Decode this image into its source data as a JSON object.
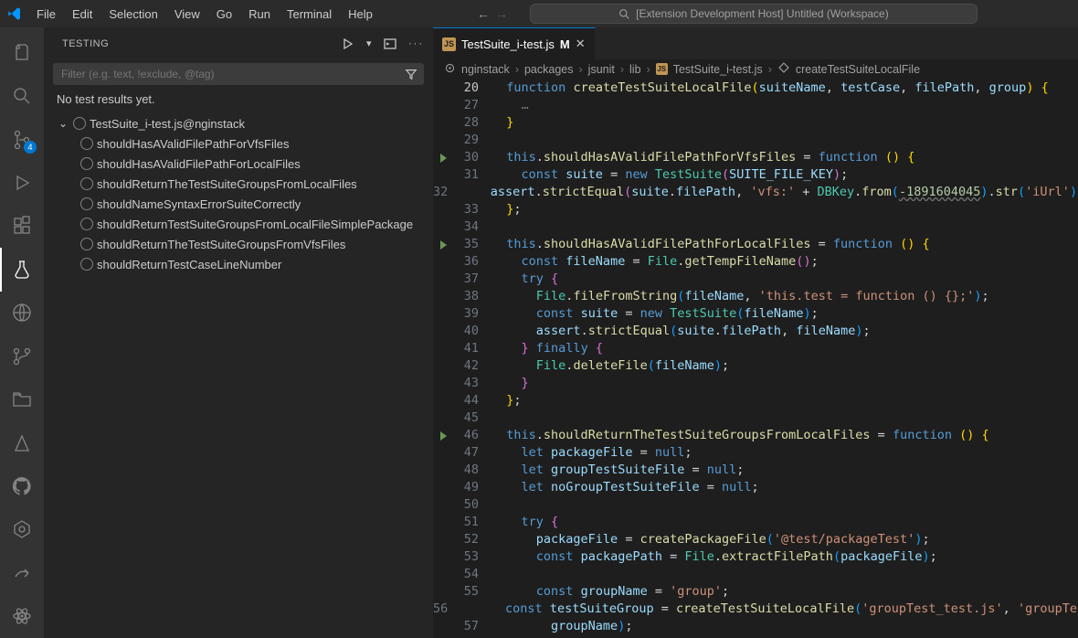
{
  "menu": [
    "File",
    "Edit",
    "Selection",
    "View",
    "Go",
    "Run",
    "Terminal",
    "Help"
  ],
  "title_search": "[Extension Development Host] Untitled (Workspace)",
  "activity_badge": 4,
  "testing": {
    "panel_title": "TESTING",
    "filter_placeholder": "Filter (e.g. text, !exclude, @tag)",
    "no_results": "No test results yet.",
    "suite_label": "TestSuite_i-test.js@nginstack",
    "tests": [
      "shouldHasAValidFilePathForVfsFiles",
      "shouldHasAValidFilePathForLocalFiles",
      "shouldReturnTheTestSuiteGroupsFromLocalFiles",
      "shouldNameSyntaxErrorSuiteCorrectly",
      "shouldReturnTestSuiteGroupsFromLocalFileSimplePackage",
      "shouldReturnTheTestSuiteGroupsFromVfsFiles",
      "shouldReturnTestCaseLineNumber"
    ]
  },
  "tab": {
    "filename": "TestSuite_i-test.js",
    "modified_marker": "M"
  },
  "breadcrumb": [
    "nginstack",
    "packages",
    "jsunit",
    "lib",
    "TestSuite_i-test.js",
    "createTestSuiteLocalFile"
  ],
  "code_lines": [
    {
      "n": 20,
      "c": "",
      "html": "  <span class='kw'>function</span> <span class='fn'>createTestSuiteLocalFile</span><span class='p1'>(</span><span class='vr'>suiteName</span>, <span class='vr'>testCase</span>, <span class='vr'>filePath</span>, <span class='vr'>group</span><span class='p1'>)</span> <span class='p1'>{</span>"
    },
    {
      "n": 27,
      "html": "    <span class='fn' style='color:#6e7681'>…</span>"
    },
    {
      "n": 28,
      "html": "  <span class='p1'>}</span>"
    },
    {
      "n": 29,
      "html": ""
    },
    {
      "n": 30,
      "glyph": true,
      "html": "  <span class='kw'>this</span>.<span class='fn'>shouldHasAValidFilePathForVfsFiles</span> = <span class='kw'>function</span> <span class='p1'>(</span><span class='p1'>)</span> <span class='p1'>{</span>"
    },
    {
      "n": 31,
      "html": "    <span class='kw'>const</span> <span class='vr'>suite</span> = <span class='kw'>new</span> <span class='ty'>TestSuite</span><span class='p2'>(</span><span class='vr'>SUITE_FILE_KEY</span><span class='p2'>)</span>;"
    },
    {
      "n": 32,
      "html": "    <span class='vr'>assert</span>.<span class='fn'>strictEqual</span><span class='p2'>(</span><span class='vr'>suite</span>.<span class='vr'>filePath</span>, <span class='st'>'vfs:'</span> + <span class='ty'>DBKey</span>.<span class='fn'>from</span><span class='p3'>(</span><span class='nm ul'>-1891604045</span><span class='p3'>)</span>.<span class='fn'>str</span><span class='p3'>(</span><span class='st'>'iUrl'</span><span class='p3'>)</span><span class='p2'>)</span>"
    },
    {
      "n": 33,
      "html": "  <span class='p1'>}</span>;"
    },
    {
      "n": 34,
      "html": ""
    },
    {
      "n": 35,
      "glyph": true,
      "html": "  <span class='kw'>this</span>.<span class='fn'>shouldHasAValidFilePathForLocalFiles</span> = <span class='kw'>function</span> <span class='p1'>(</span><span class='p1'>)</span> <span class='p1'>{</span>"
    },
    {
      "n": 36,
      "html": "    <span class='kw'>const</span> <span class='vr'>fileName</span> = <span class='ty'>File</span>.<span class='fn'>getTempFileName</span><span class='p2'>(</span><span class='p2'>)</span>;"
    },
    {
      "n": 37,
      "html": "    <span class='kw'>try</span> <span class='p2'>{</span>"
    },
    {
      "n": 38,
      "html": "      <span class='ty'>File</span>.<span class='fn'>fileFromString</span><span class='p3'>(</span><span class='vr'>fileName</span>, <span class='st'>'this.test = function () {};'</span><span class='p3'>)</span>;"
    },
    {
      "n": 39,
      "html": "      <span class='kw'>const</span> <span class='vr'>suite</span> = <span class='kw'>new</span> <span class='ty'>TestSuite</span><span class='p3'>(</span><span class='vr'>fileName</span><span class='p3'>)</span>;"
    },
    {
      "n": 40,
      "html": "      <span class='vr'>assert</span>.<span class='fn'>strictEqual</span><span class='p3'>(</span><span class='vr'>suite</span>.<span class='vr'>filePath</span>, <span class='vr'>fileName</span><span class='p3'>)</span>;"
    },
    {
      "n": 41,
      "html": "    <span class='p2'>}</span> <span class='kw'>finally</span> <span class='p2'>{</span>"
    },
    {
      "n": 42,
      "html": "      <span class='ty'>File</span>.<span class='fn'>deleteFile</span><span class='p3'>(</span><span class='vr'>fileName</span><span class='p3'>)</span>;"
    },
    {
      "n": 43,
      "html": "    <span class='p2'>}</span>"
    },
    {
      "n": 44,
      "html": "  <span class='p1'>}</span>;"
    },
    {
      "n": 45,
      "html": ""
    },
    {
      "n": 46,
      "glyph": true,
      "html": "  <span class='kw'>this</span>.<span class='fn'>shouldReturnTheTestSuiteGroupsFromLocalFiles</span> = <span class='kw'>function</span> <span class='p1'>(</span><span class='p1'>)</span> <span class='p1'>{</span>"
    },
    {
      "n": 47,
      "html": "    <span class='kw'>let</span> <span class='vr'>packageFile</span> = <span class='kw'>null</span>;"
    },
    {
      "n": 48,
      "html": "    <span class='kw'>let</span> <span class='vr'>groupTestSuiteFile</span> = <span class='kw'>null</span>;"
    },
    {
      "n": 49,
      "html": "    <span class='kw'>let</span> <span class='vr'>noGroupTestSuiteFile</span> = <span class='kw'>null</span>;"
    },
    {
      "n": 50,
      "html": ""
    },
    {
      "n": 51,
      "html": "    <span class='kw'>try</span> <span class='p2'>{</span>"
    },
    {
      "n": 52,
      "html": "      <span class='vr'>packageFile</span> = <span class='fn'>createPackageFile</span><span class='p3'>(</span><span class='st'>'@test/packageTest'</span><span class='p3'>)</span>;"
    },
    {
      "n": 53,
      "html": "      <span class='kw'>const</span> <span class='vr'>packagePath</span> = <span class='ty'>File</span>.<span class='fn'>extractFilePath</span><span class='p3'>(</span><span class='vr'>packageFile</span><span class='p3'>)</span>;"
    },
    {
      "n": 54,
      "html": ""
    },
    {
      "n": 55,
      "html": "      <span class='kw'>const</span> <span class='vr'>groupName</span> = <span class='st'>'group'</span>;"
    },
    {
      "n": 56,
      "html": "      <span class='kw'>const</span> <span class='vr'>testSuiteGroup</span> = <span class='fn'>createTestSuiteLocalFile</span><span class='p3'>(</span><span class='st'>'groupTest_test.js'</span>, <span class='st'>'groupTes</span>"
    },
    {
      "n": 57,
      "html": "        <span class='vr'>groupName</span><span class='p3'>)</span>;"
    }
  ]
}
